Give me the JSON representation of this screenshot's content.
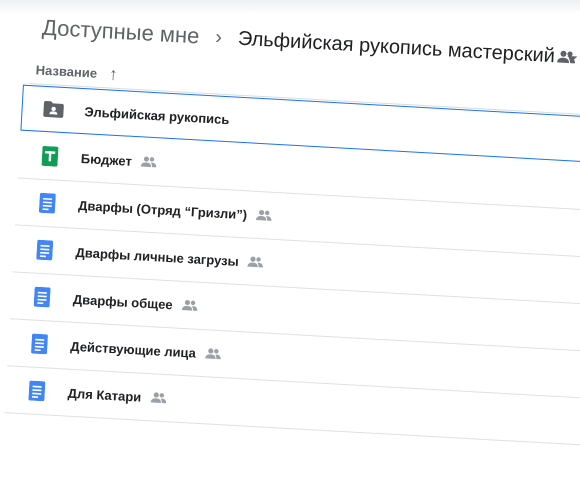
{
  "breadcrumb": {
    "root": "Доступные мне",
    "separator": "›",
    "current": "Эльфийская рукопись мастерский"
  },
  "list_header": {
    "column_name": "Название",
    "sort_icon": "arrow-up-icon"
  },
  "items": [
    {
      "name": "Эльфийская рукопись",
      "type": "folder",
      "icon": "shared-folder-icon",
      "shared": false,
      "selected": true
    },
    {
      "name": "Бюджет",
      "type": "spreadsheet",
      "icon": "sheets-icon",
      "shared": true,
      "selected": false
    },
    {
      "name": "Дварфы (Отряд “Гризли”)",
      "type": "document",
      "icon": "docs-icon",
      "shared": true,
      "selected": false
    },
    {
      "name": "Дварфы личные загрузы",
      "type": "document",
      "icon": "docs-icon",
      "shared": true,
      "selected": false
    },
    {
      "name": "Дварфы общее",
      "type": "document",
      "icon": "docs-icon",
      "shared": true,
      "selected": false
    },
    {
      "name": "Действующие лица",
      "type": "document",
      "icon": "docs-icon",
      "shared": true,
      "selected": false
    },
    {
      "name": "Для Катари",
      "type": "document",
      "icon": "docs-icon",
      "shared": true,
      "selected": false
    }
  ],
  "colors": {
    "selection_border": "#1a73e8",
    "docs_blue": "#4285f4",
    "sheets_green": "#0f9d58",
    "folder_dark": "#5f6368",
    "text_primary": "#202124",
    "text_secondary": "#5f6368"
  }
}
